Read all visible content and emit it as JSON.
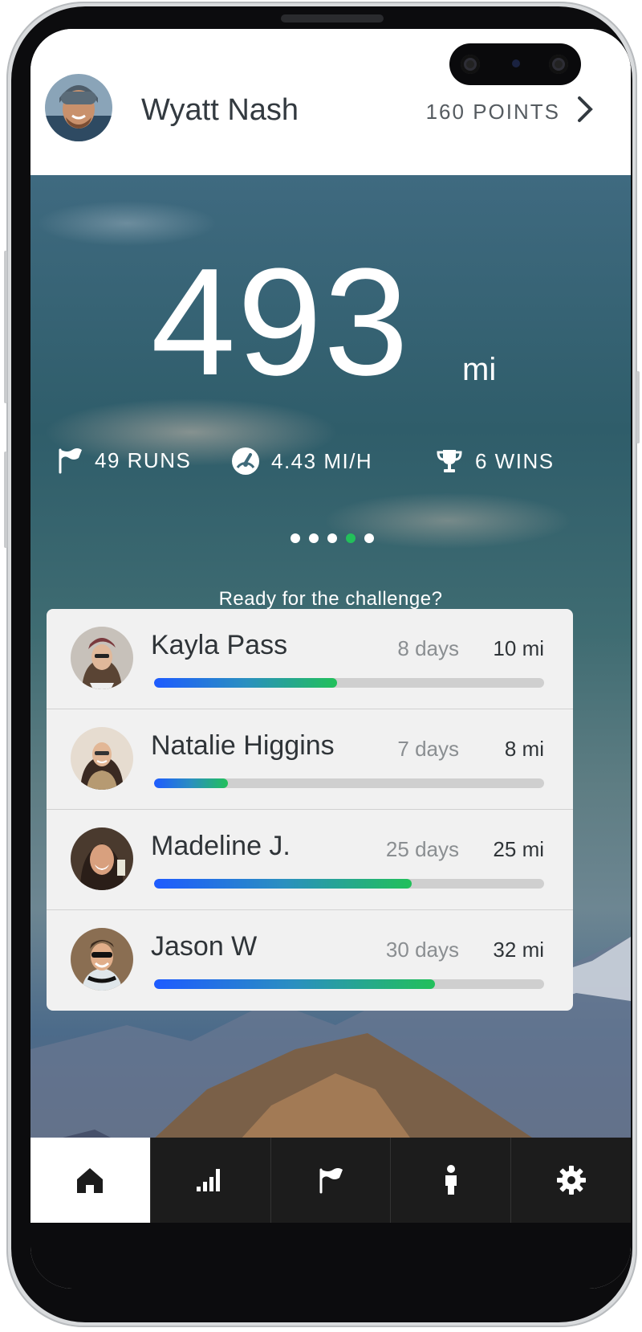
{
  "header": {
    "user_name": "Wyatt Nash",
    "points": "160 POINTS"
  },
  "hero": {
    "distance": "493",
    "unit": "mi",
    "stats": {
      "runs": "49 RUNS",
      "speed": "4.43 MI/H",
      "wins": "6 WINS"
    },
    "carousel": {
      "count": 5,
      "active_index": 3
    },
    "tagline": "Ready for the challenge?"
  },
  "challenges": [
    {
      "name": "Kayla Pass",
      "days": "8 days",
      "distance": "10 mi",
      "progress": 0.47
    },
    {
      "name": "Natalie Higgins",
      "days": "7 days",
      "distance": "8 mi",
      "progress": 0.19
    },
    {
      "name": "Madeline J.",
      "days": "25 days",
      "distance": "25 mi",
      "progress": 0.66
    },
    {
      "name": "Jason W",
      "days": "30 days",
      "distance": "32 mi",
      "progress": 0.72
    }
  ],
  "tabs": [
    {
      "icon": "home-icon",
      "active": true
    },
    {
      "icon": "signal-bars-icon",
      "active": false
    },
    {
      "icon": "flag-icon",
      "active": false
    },
    {
      "icon": "person-icon",
      "active": false
    },
    {
      "icon": "gear-icon",
      "active": false
    }
  ],
  "colors": {
    "progress_start": "#1e5bff",
    "progress_end": "#22c05a",
    "active_dot": "#22c05a",
    "tabbar_bg": "#1c1c1c"
  }
}
